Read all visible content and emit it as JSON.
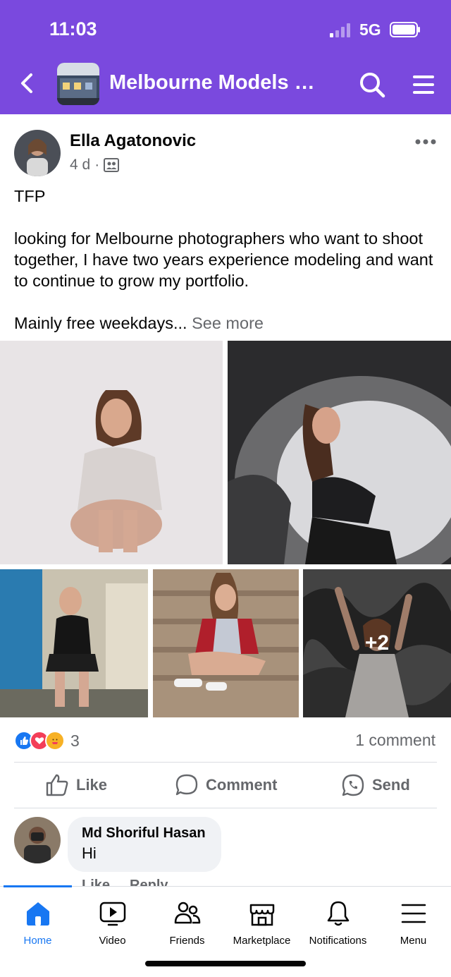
{
  "status_bar": {
    "time": "11:03",
    "network": "5G"
  },
  "header": {
    "group_title": "Melbourne Models &...",
    "back_icon": "chevron-left-icon",
    "search_icon": "search-icon",
    "menu_icon": "hamburger-menu-icon",
    "background_color": "#7a49de"
  },
  "post": {
    "author": "Ella Agatonovic",
    "time": "4 d",
    "audience_icon": "group-members-icon",
    "paragraphs": [
      "TFP",
      "looking for Melbourne photographers who want to shoot together, I have two years experience modeling and want to continue to grow my portfolio.",
      "Mainly free weekdays..."
    ],
    "see_more": "See more",
    "photos_extra_count": "+2",
    "reaction_count": "3",
    "comment_count": "1 comment",
    "actions": {
      "like": "Like",
      "comment": "Comment",
      "send": "Send"
    }
  },
  "comment": {
    "author": "Md Shoriful Hasan",
    "text": "Hi",
    "like": "Like",
    "reply": "Reply"
  },
  "bottom_nav": {
    "items": [
      {
        "label": "Home",
        "icon": "home-icon",
        "active": true
      },
      {
        "label": "Video",
        "icon": "video-icon",
        "active": false
      },
      {
        "label": "Friends",
        "icon": "friends-icon",
        "active": false
      },
      {
        "label": "Marketplace",
        "icon": "marketplace-icon",
        "active": false
      },
      {
        "label": "Notifications",
        "icon": "bell-icon",
        "active": false
      },
      {
        "label": "Menu",
        "icon": "hamburger-menu-icon",
        "active": false
      }
    ]
  },
  "colors": {
    "accent": "#1877f2",
    "header": "#7a49de",
    "muted_text": "#65676b"
  }
}
